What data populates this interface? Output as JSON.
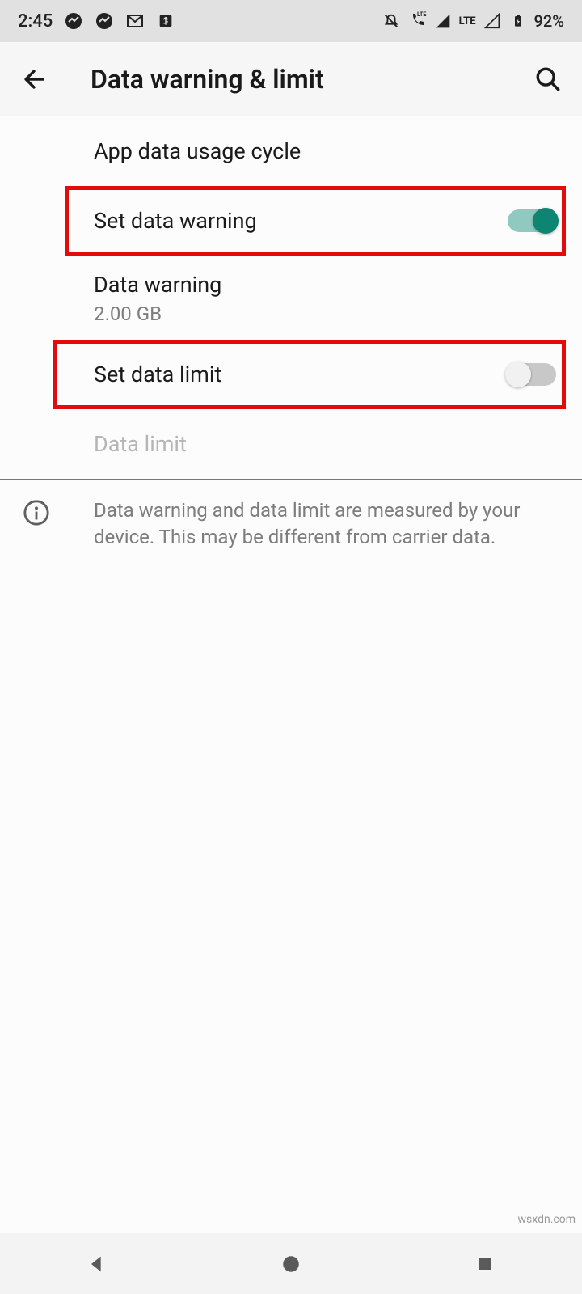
{
  "status": {
    "time": "2:45",
    "battery": "92%"
  },
  "header": {
    "title": "Data warning & limit"
  },
  "rows": {
    "usage_cycle": "App data usage cycle",
    "set_warning": "Set data warning",
    "data_warning_title": "Data warning",
    "data_warning_value": "2.00 GB",
    "set_limit": "Set data limit",
    "data_limit": "Data limit"
  },
  "info": "Data warning and data limit are measured by your device. This may be different from carrier data.",
  "watermark": "wsxdn.com"
}
